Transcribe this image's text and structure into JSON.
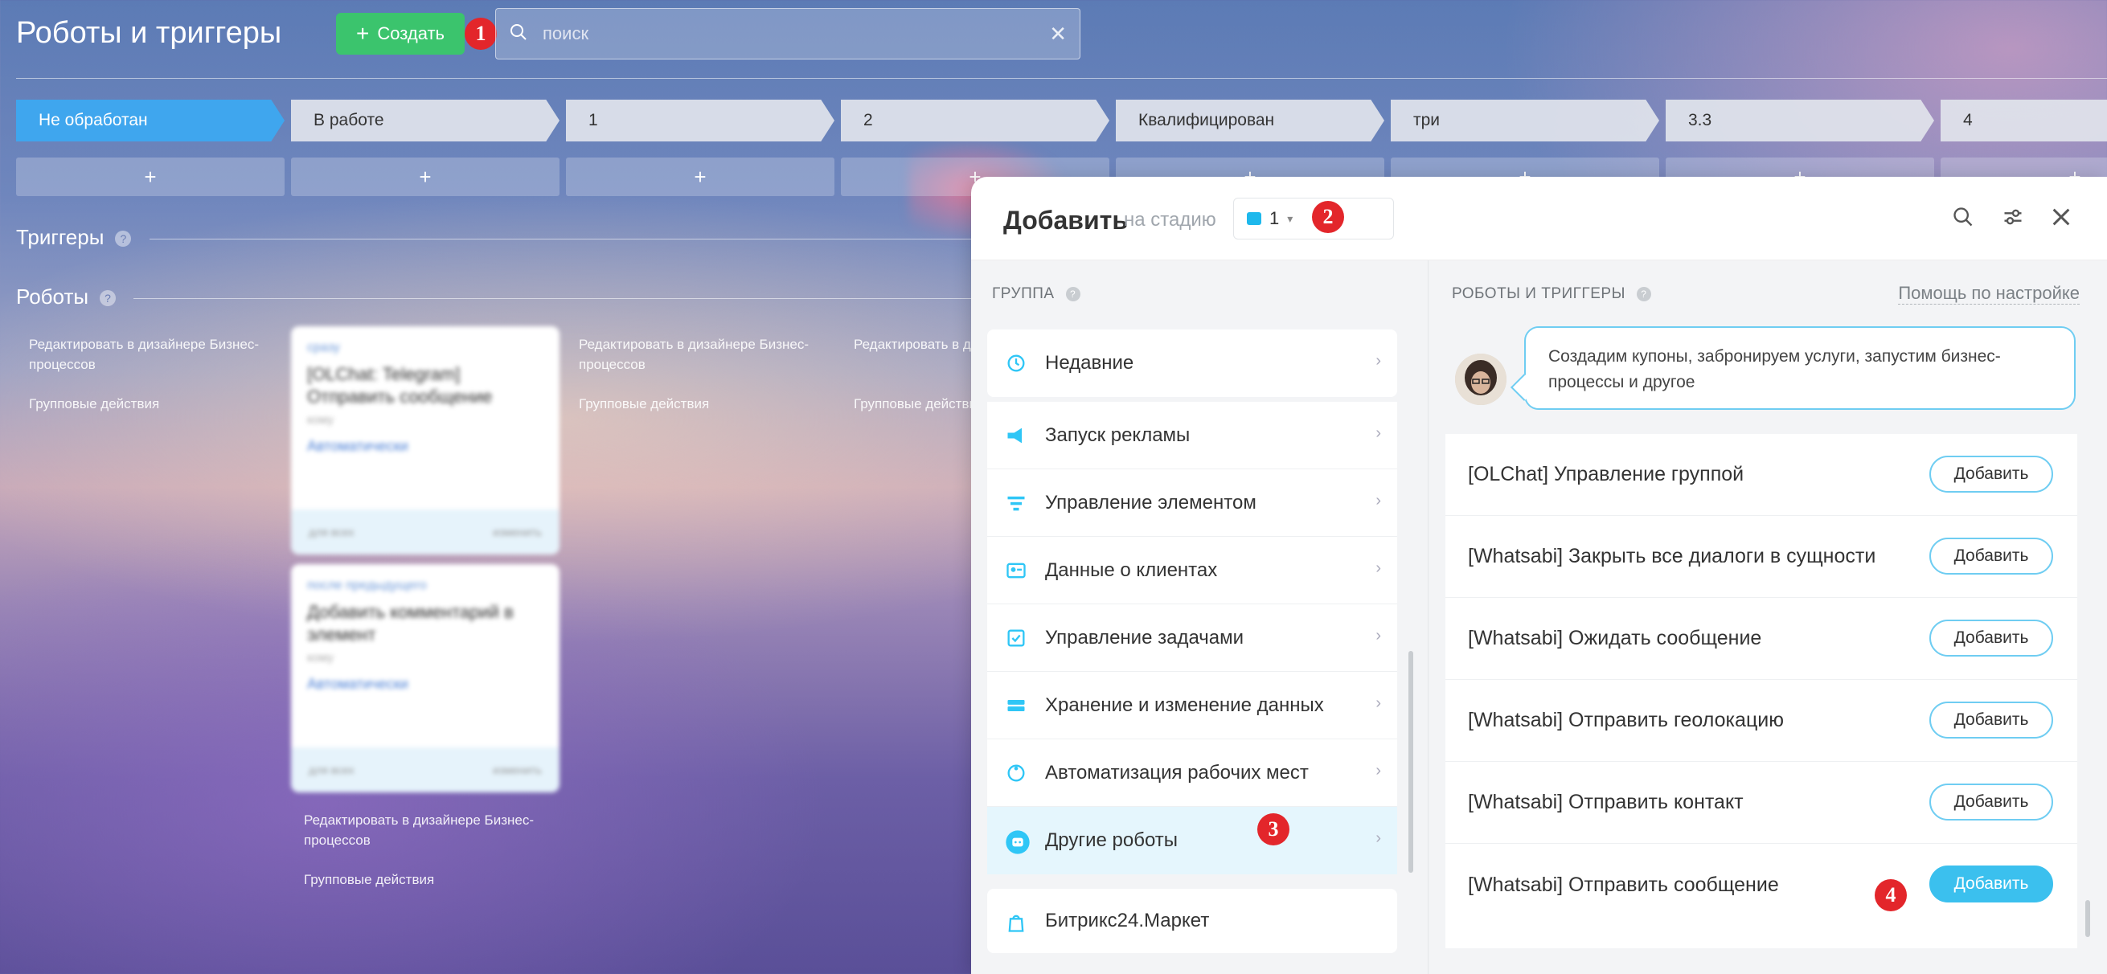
{
  "header": {
    "title": "Роботы и триггеры",
    "create_label": "Создать",
    "search_placeholder": "поиск"
  },
  "markers": [
    "1",
    "2",
    "3",
    "4"
  ],
  "stages": [
    {
      "label": "Не обработан",
      "active": true
    },
    {
      "label": "В работе"
    },
    {
      "label": "1"
    },
    {
      "label": "2"
    },
    {
      "label": "Квалифицирован"
    },
    {
      "label": "три"
    },
    {
      "label": "3.3"
    },
    {
      "label": "4"
    }
  ],
  "add_symbol": "+",
  "sections": {
    "triggers": "Триггеры",
    "robots": "Роботы",
    "help_symbol": "?"
  },
  "column_links": {
    "edit_designer": "Редактировать в дизайнере Бизнес-процессов",
    "group_actions": "Групповые действия"
  },
  "robot_cards": [
    {
      "condition": "сразу",
      "title": "[OLChat: Telegram] Отправить сообщение",
      "who": "кому",
      "auto": "Автоматически",
      "foot_left": "для всех",
      "foot_right": "изменить"
    },
    {
      "condition": "после предыдущего",
      "title": "Добавить комментарий в элемент",
      "who": "кому",
      "auto": "Автоматически",
      "foot_left": "для всех",
      "foot_right": "изменить"
    }
  ],
  "panel": {
    "title": "Добавить",
    "subtitle": "на стадию",
    "stage_value": "1",
    "group_label": "ГРУППА",
    "robots_label": "РОБОТЫ И ТРИГГЕРЫ",
    "help_link": "Помощь по настройке",
    "bubble_text": "Создадим купоны, забронируем услуги, запустим бизнес-процессы и другое",
    "recent": "Недавние",
    "groups": [
      {
        "label": "Запуск рекламы",
        "icon": "megaphone-icon"
      },
      {
        "label": "Управление элементом",
        "icon": "funnel-icon"
      },
      {
        "label": "Данные о клиентах",
        "icon": "contact-card-icon"
      },
      {
        "label": "Управление задачами",
        "icon": "task-icon"
      },
      {
        "label": "Хранение и изменение данных",
        "icon": "storage-icon"
      },
      {
        "label": "Автоматизация рабочих мест",
        "icon": "automation-icon"
      },
      {
        "label": "Другие роботы",
        "icon": "robot-icon",
        "selected": true
      }
    ],
    "market": "Битрикс24.Маркет",
    "add_label": "Добавить",
    "robots": [
      "[OLChat] Управление группой",
      "[Whatsabi] Закрыть все диалоги в сущности",
      "[Whatsabi] Ожидать сообщение",
      "[Whatsabi] Отправить геолокацию",
      "[Whatsabi] Отправить контакт",
      "[Whatsabi] Отправить сообщение"
    ]
  },
  "colors": {
    "accent": "#3fa6ee",
    "create": "#3bc46d",
    "marker": "#e3262b",
    "add_primary": "#3bc0ee"
  }
}
